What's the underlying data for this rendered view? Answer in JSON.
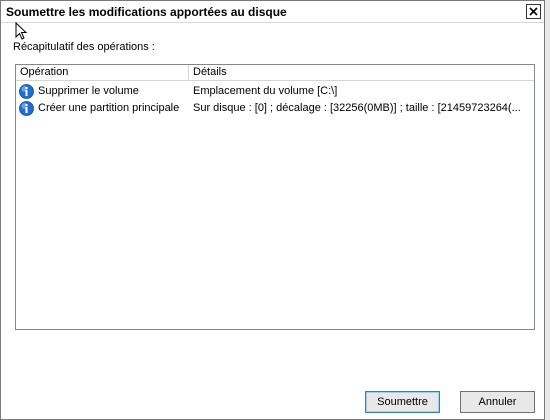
{
  "dialog": {
    "title": "Soumettre les modifications apportées au disque",
    "summary_label": "Récapitulatif des opérations :"
  },
  "list": {
    "columns": [
      "Opération",
      "Détails"
    ],
    "rows": [
      {
        "icon": "info-icon",
        "operation": "Supprimer le volume",
        "details": "Emplacement du volume [C:\\]"
      },
      {
        "icon": "info-icon",
        "operation": "Créer une partition principale",
        "details": "Sur disque : [0] ; décalage : [32256(0MB)] ; taille : [21459723264(..."
      }
    ]
  },
  "buttons": {
    "submit": "Soumettre",
    "cancel": "Annuler"
  },
  "colors": {
    "info_icon": "#1e6fd0"
  }
}
